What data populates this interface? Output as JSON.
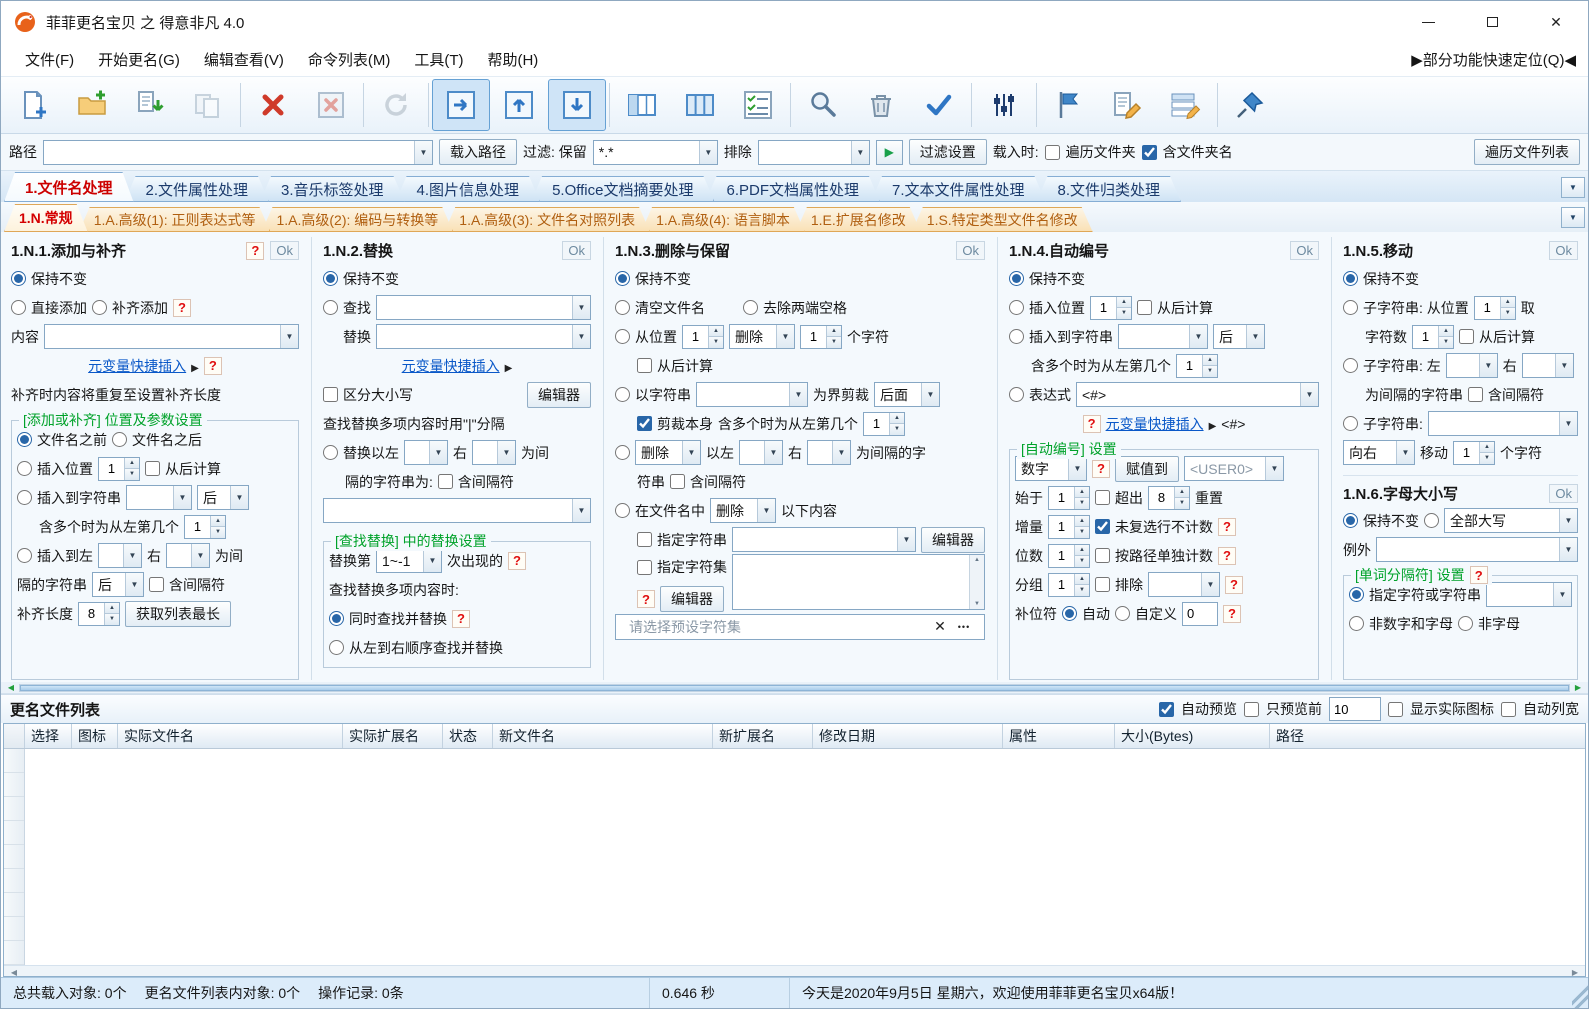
{
  "window": {
    "title": "菲菲更名宝贝 之 得意非凡 4.0"
  },
  "ui": {
    "ok": "Ok",
    "q": "?"
  },
  "menu": {
    "items": [
      "文件(F)",
      "开始更名(G)",
      "编辑查看(V)",
      "命令列表(M)",
      "工具(T)",
      "帮助(H)"
    ],
    "quick": "▶部分功能快速定位(Q)◀"
  },
  "toolbar": {
    "buttons": [
      "new-file",
      "open-folder",
      "load-list",
      "save-list",
      "delete",
      "clear-list",
      "refresh",
      "move-right",
      "move-up",
      "move-down",
      "first-column",
      "column-view",
      "check-list",
      "search",
      "filter-trash",
      "apply-check",
      "adjust-sliders",
      "flag-filter",
      "edit-name",
      "edit-list",
      "pin-top"
    ]
  },
  "pathbar": {
    "path_label": "路径",
    "path_value": "",
    "load_path": "载入路径",
    "filter_label": "过滤: 保留",
    "filter_value": "*.*",
    "exclude_label": "排除",
    "exclude_value": "",
    "filter_settings": "过滤设置",
    "load_when": "载入时:",
    "traverse_folders": "遍历文件夹",
    "traverse_folders_on": false,
    "include_folder": "含文件夹名",
    "include_folder_on": true,
    "traverse_list": "遍历文件列表"
  },
  "tabs1": {
    "items": [
      "1.文件名处理",
      "2.文件属性处理",
      "3.音乐标签处理",
      "4.图片信息处理",
      "5.Office文档摘要处理",
      "6.PDF文档属性处理",
      "7.文本文件属性处理",
      "8.文件归类处理"
    ]
  },
  "tabs2": {
    "items": [
      "1.N.常规",
      "1.A.高级(1): 正则表达式等",
      "1.A.高级(2): 编码与转换等",
      "1.A.高级(3): 文件名对照列表",
      "1.A.高级(4): 语言脚本",
      "1.E.扩展名修改",
      "1.S.特定类型文件名修改"
    ]
  },
  "p1": {
    "title": "1.N.1.添加与补齐",
    "keep": "保持不变",
    "keep_on": true,
    "direct": "直接添加",
    "pad": "补齐添加",
    "content": "内容",
    "content_value": "",
    "meta": "元变量快捷插入",
    "note": "补齐时内容将重复至设置补齐长度",
    "sec": "[添加或补齐] 位置及参数设置",
    "before": "文件名之前",
    "before_on": true,
    "after": "文件名之后",
    "pos": "插入位置",
    "pos_v": "1",
    "from_end": "从后计算",
    "tostr": "插入到字符串",
    "after_v": "后",
    "multi": "含多个时为从左第几个",
    "multi_v": "1",
    "toleft": "插入到左",
    "right": "右",
    "weijian": "为间",
    "sep": "隔的字符串",
    "after2_v": "后",
    "inc_sep": "含间隔符",
    "padlen": "补齐长度",
    "padlen_v": "8",
    "longest": "获取列表最长"
  },
  "p2": {
    "title": "1.N.2.替换",
    "keep": "保持不变",
    "keep_on": true,
    "find": "查找",
    "find_value": "",
    "repl": "替换",
    "repl_value": "",
    "meta": "元变量快捷插入",
    "case": "区分大小写",
    "editor": "编辑器",
    "note": "查找替换多项内容时用\"|\"分隔",
    "byleft": "替换以左",
    "right": "右",
    "weijian": "为间",
    "sep": "隔的字符串为:",
    "inc_sep": "含间隔符",
    "sec": "[查找替换] 中的替换设置",
    "nth": "替换第",
    "nth_v": "1~-1",
    "occur": "次出现的",
    "multi": "查找替换多项内容时:",
    "simul": "同时查找并替换",
    "simul_on": true,
    "seq": "从左到右顺序查找并替换"
  },
  "p3": {
    "title": "1.N.3.删除与保留",
    "keep": "保持不变",
    "keep_on": true,
    "clear": "清空文件名",
    "trim": "去除两端空格",
    "frompos": "从位置",
    "pos_v": "1",
    "del_v": "删除",
    "cnt_v": "1",
    "chars": "个字符",
    "from_end": "从后计算",
    "bystr": "以字符串",
    "bound": "为界剪裁",
    "back_v": "后面",
    "cutself": "剪裁本身",
    "cutself_on": true,
    "multi": "含多个时为从左第几个",
    "multi_v": "1",
    "del2_v": "删除",
    "left": "以左",
    "right": "右",
    "interval": "为间隔的字",
    "cont": "符串",
    "inc_sep": "含间隔符",
    "infile": "在文件名中",
    "del3_v": "删除",
    "following": "以下内容",
    "specstr": "指定字符串",
    "specstr_value": "",
    "editor": "编辑器",
    "charset": "指定字符集",
    "charset_value": "",
    "preset": "请选择预设字符集"
  },
  "p4": {
    "title": "1.N.4.自动编号",
    "keep": "保持不变",
    "keep_on": true,
    "pos": "插入位置",
    "pos_v": "1",
    "from_end": "从后计算",
    "tostr": "插入到字符串",
    "tostr_value": "",
    "after_v": "后",
    "multi": "含多个时为从左第几个",
    "multi_v": "1",
    "expr": "表达式",
    "expr_v": "<#>",
    "meta": "元变量快捷插入",
    "tag": "<#>",
    "sec": "[自动编号] 设置",
    "type_v": "数字",
    "assign": "赋值到",
    "assign_v": "<USER0>",
    "start": "始于",
    "start_v": "1",
    "over": "超出",
    "over_v": "8",
    "reset": "重置",
    "inc": "增量",
    "inc_v": "1",
    "nocount": "未复选行不计数",
    "nocount_on": true,
    "digits": "位数",
    "digits_v": "1",
    "perpath": "按路径单独计数",
    "group": "分组",
    "group_v": "1",
    "excl": "排除",
    "excl_value": "",
    "padc": "补位符",
    "auto": "自动",
    "auto_on": true,
    "custom": "自定义",
    "custom_v": "0"
  },
  "p5": {
    "title": "1.N.5.移动",
    "keep": "保持不变",
    "keep_on": true,
    "sub1": "子字符串: 从位置",
    "p_v": "1",
    "take": "取",
    "cnt": "字符数",
    "cnt_v": "1",
    "from_end": "从后计算",
    "sub2": "子字符串: 左",
    "right": "右",
    "interval": "为间隔的字符串",
    "inc_sep": "含间隔符",
    "sub3": "子字符串:",
    "sub3_value": "",
    "dir_v": "向右",
    "move": "移动",
    "move_v": "1",
    "chars": "个字符"
  },
  "p6": {
    "title": "1.N.6.字母大小写",
    "keep": "保持不变",
    "keep_on": true,
    "upper_v": "全部大写",
    "except": "例外",
    "except_value": "",
    "sec": "[单词分隔符] 设置",
    "spec": "指定字符或字符串",
    "spec_on": true,
    "spec_value": "",
    "nonan": "非数字和字母",
    "nonalpha": "非字母"
  },
  "listbar": {
    "title": "更名文件列表",
    "auto_prev": "自动预览",
    "auto_prev_on": true,
    "prev_first": "只预览前",
    "prev_v": "10",
    "show_icon": "显示实际图标",
    "auto_w": "自动列宽"
  },
  "table": {
    "columns": [
      "选择",
      "图标",
      "实际文件名",
      "实际扩展名",
      "状态",
      "新文件名",
      "新扩展名",
      "修改日期",
      "属性",
      "大小(Bytes)",
      "路径"
    ]
  },
  "status": {
    "loaded": "总共载入对象: 0个",
    "inlist": "更名文件列表内对象: 0个",
    "ops": "操作记录: 0条",
    "time": "0.646 秒",
    "msg": "今天是2020年9月5日 星期六，欢迎使用菲菲更名宝贝x64版！"
  }
}
